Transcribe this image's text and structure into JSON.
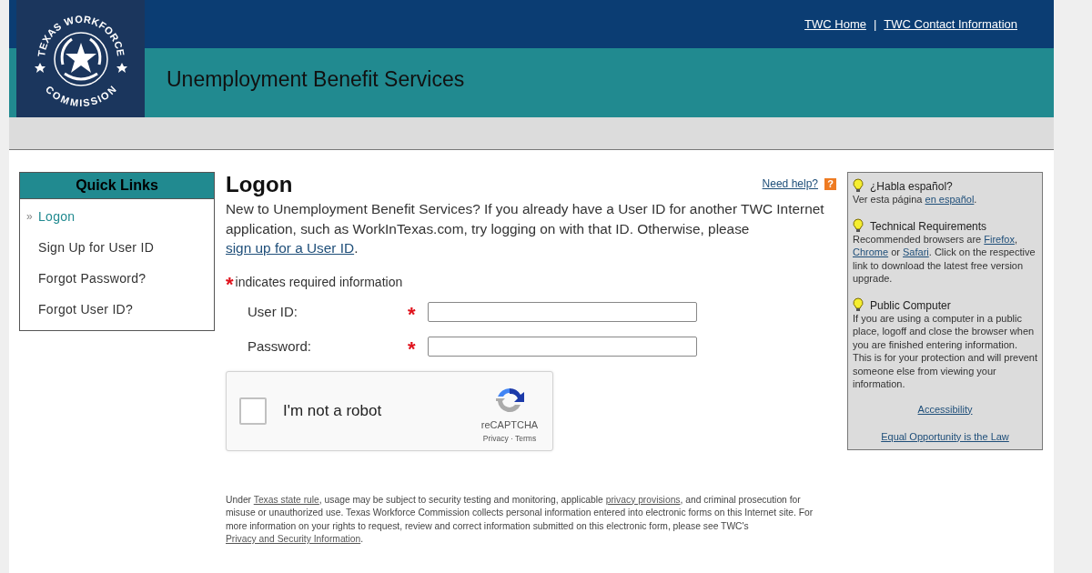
{
  "header": {
    "logo": {
      "top_text": "TEXAS WORKFORCE",
      "bottom_text": "COMMISSION"
    },
    "links": [
      {
        "label": "TWC Home"
      },
      {
        "label": "TWC Contact Information"
      }
    ],
    "separator": "|",
    "title": "Unemployment Benefit Services"
  },
  "quick_links": {
    "title": "Quick Links",
    "marker": "»",
    "items": [
      {
        "label": "Logon",
        "selected": true
      },
      {
        "label": "Sign Up for User ID",
        "selected": false
      },
      {
        "label": "Forgot Password?",
        "selected": false
      },
      {
        "label": "Forgot User ID?",
        "selected": false
      }
    ]
  },
  "logon": {
    "heading": "Logon",
    "help_link": "Need help?",
    "help_icon": "?",
    "intro": [
      {
        "text": "New to Unemployment Benefit Services? If you already have a User ID for another TWC Internet application, such as WorkInTexas.com, try logging on with that ID. Otherwise, please ",
        "link": false
      },
      {
        "text": "sign up for a User ID",
        "link": true
      },
      {
        "text": ".",
        "link": false
      }
    ],
    "required_legend": {
      "mark": "*",
      "text": "indicates required information"
    },
    "fields": [
      {
        "label": "User ID:",
        "required": true
      },
      {
        "label": "Password:",
        "required": true
      }
    ],
    "captcha": {
      "label": "I'm not a robot",
      "checked": false,
      "brand": "reCAPTCHA",
      "terms": "Privacy · Terms"
    },
    "footer": [
      {
        "text": "Under ",
        "link": false
      },
      {
        "text": "Texas state rule",
        "link": true
      },
      {
        "text": ", usage may be subject to security testing and monitoring, applicable ",
        "link": false
      },
      {
        "text": "privacy provisions",
        "link": true
      },
      {
        "text": ", and criminal prosecution for misuse or unauthorized use. Texas Workforce Commission collects personal information entered into electronic forms on this Internet site. For more information on your rights to request, review and correct information submitted on this electronic form, please see TWC's ",
        "link": false
      },
      {
        "text": "Privacy and Security Information",
        "link": true
      },
      {
        "text": ".",
        "link": false
      }
    ]
  },
  "side_panel": {
    "sections": [
      {
        "title": "¿Habla español?",
        "body": [
          {
            "text": "Ver esta página ",
            "link": false
          },
          {
            "text": "en español",
            "link": true
          },
          {
            "text": ".",
            "link": false
          }
        ]
      },
      {
        "title": "Technical Requirements",
        "body": [
          {
            "text": "Recommended browsers are ",
            "link": false
          },
          {
            "text": "Firefox",
            "link": true
          },
          {
            "text": ", ",
            "link": false
          },
          {
            "text": "Chrome",
            "link": true
          },
          {
            "text": " or ",
            "link": false
          },
          {
            "text": "Safari",
            "link": true
          },
          {
            "text": ". Click on the respective link to download the latest free version upgrade.",
            "link": false
          }
        ]
      },
      {
        "title": "Public Computer",
        "body": [
          {
            "text": "If you are using a computer in a public place, logoff and close the browser when you are finished entering information. This is for your protection and will prevent someone else from viewing your information.",
            "link": false
          }
        ]
      }
    ],
    "links": [
      {
        "label": "Accessibility"
      },
      {
        "label": "Equal Opportunity is the Law"
      }
    ]
  }
}
